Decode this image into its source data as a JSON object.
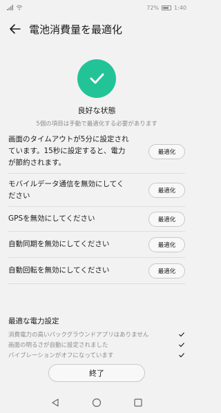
{
  "status_bar": {
    "battery": "72%",
    "time": "1:40"
  },
  "header": {
    "title": "電池消費量を最適化"
  },
  "hero": {
    "status": "良好な状態",
    "subtitle": "5個の項目は手動で最適化する必要があります",
    "accent_color": "#22c497"
  },
  "items": [
    {
      "text_lines": [
        "画面のタイムアウトが5分に設定され",
        "ています。15秒に設定すると、電力",
        "が節約されます。"
      ],
      "button": "最適化"
    },
    {
      "text_lines": [
        "モバイルデータ通信を無効にしてく",
        "ださい"
      ],
      "button": "最適化"
    },
    {
      "text_lines": [
        "GPSを無効にしてください"
      ],
      "button": "最適化"
    },
    {
      "text_lines": [
        "自動同期を無効にしてください"
      ],
      "button": "最適化"
    },
    {
      "text_lines": [
        "自動回転を無効にしてください"
      ],
      "button": "最適化"
    }
  ],
  "optimal": {
    "title": "最適な電力設定",
    "items": [
      "消費電力の高いバックグラウンドアプリはありません",
      "画面の明るさが自動に設定されました",
      "バイブレーションがオフになっています"
    ]
  },
  "done_button": "終了",
  "icons": {
    "back": "back-arrow-icon",
    "check": "check-icon",
    "nav_back": "triangle-back-icon",
    "nav_home": "circle-home-icon",
    "nav_recent": "square-recent-icon"
  }
}
